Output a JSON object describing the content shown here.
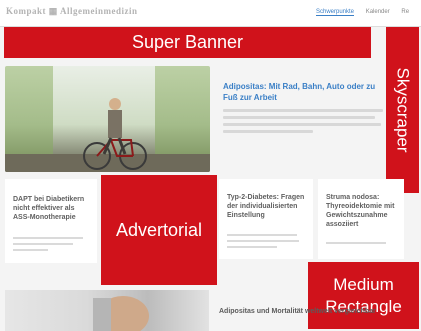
{
  "header": {
    "logo_text": "Kompakt ▦ Allgemeinmedizin",
    "nav": [
      "Schwerpunkte",
      "Kalender",
      "Re"
    ]
  },
  "ads": {
    "super_banner": "Super Banner",
    "skyscraper": "Skyscraper",
    "advertorial": "Advertorial",
    "medium_rectangle_line1": "Medium",
    "medium_rectangle_line2": "Rectangle"
  },
  "featured": {
    "title": "Adipositas: Mit Rad, Bahn, Auto oder zu Fuß zur Arbeit"
  },
  "cards": [
    {
      "title": "DAPT bei Diabetikern nicht effektiver als ASS-Monotherapie"
    },
    {
      "title": "Typ-2-Diabetes: Fragen der individualisierten Einstellung"
    },
    {
      "title": "Struma nodosa: Thyreoidektomie mit Gewichtszunahme assoziiert"
    }
  ],
  "bottom": {
    "title": "Adipositas und Mortalität weltweit vergleichbar"
  },
  "colors": {
    "ad_red": "#d0121b",
    "link_blue": "#3a7fc6"
  }
}
